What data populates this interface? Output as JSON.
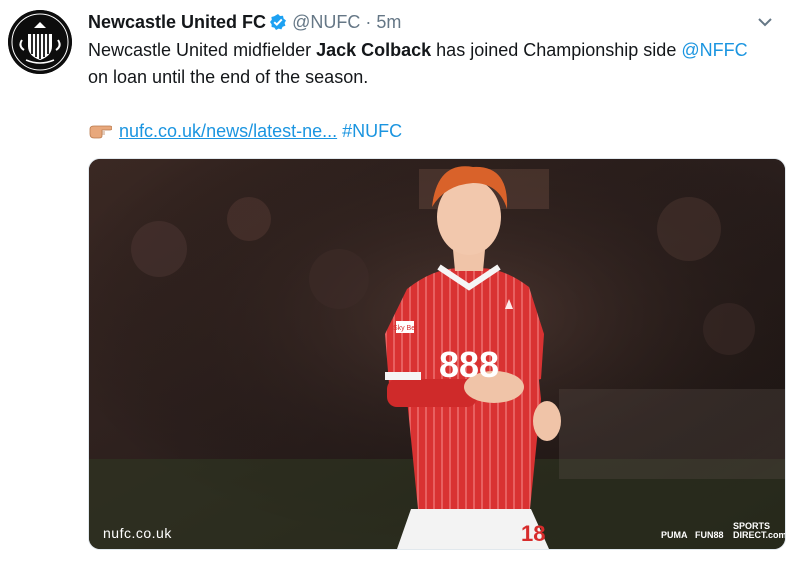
{
  "tweet": {
    "author_name": "Newcastle United FC",
    "handle": "@NUFC",
    "separator": "·",
    "time": "5m",
    "text_parts": {
      "p1": "Newcastle United midfielder ",
      "bold": "Jack Colback",
      "p2": " has joined Championship side ",
      "mention": "@NFFC",
      "p3": " on loan until the end of the season."
    },
    "link_text": "nufc.co.uk/news/latest-ne...",
    "hashtag": "#NUFC",
    "icons": [
      "nufc-crest-avatar",
      "verified-badge-icon",
      "chevron-down-icon",
      "pointing-finger-emoji"
    ]
  },
  "media": {
    "watermark": "nufc.co.uk",
    "shirt_sponsor": "888",
    "shirt_number": "18",
    "sleeve_patch": "Sky Bet",
    "kit_brand": "PUMA",
    "board_1": "FUN88",
    "board_2": "SPORTS DIRECT.com"
  },
  "colors": {
    "link": "#1b95e0",
    "verified": "#1da1f2",
    "secondary_text": "#657786",
    "kit_red": "#d72c2c"
  }
}
